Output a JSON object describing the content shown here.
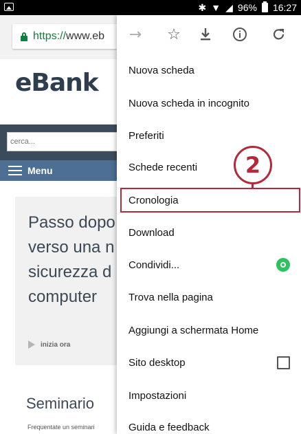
{
  "status_bar": {
    "battery": "96%",
    "time": "16:27",
    "icons": [
      "image-icon",
      "bluetooth-icon",
      "wifi-icon",
      "signal-icon",
      "battery-icon"
    ]
  },
  "browser": {
    "url_scheme": "https://",
    "url_host": "www.eb"
  },
  "page": {
    "logo": "eBank",
    "search_placeholder": "cerca...",
    "menu_label": "Menu",
    "promo_lines": [
      "Passo dopo",
      "verso una n",
      "sicurezza d",
      "computer"
    ],
    "promo_link": "inizia ora",
    "seminar_title": "Seminario",
    "seminar_sub": "Frequentate un seminari"
  },
  "overflow_menu": {
    "toolbar_icons": [
      "forward-icon",
      "star-icon",
      "download-icon",
      "info-icon",
      "refresh-icon"
    ],
    "items": [
      "Nuova scheda",
      "Nuova scheda in incognito",
      "Preferiti",
      "Schede recenti",
      "Cronologia",
      "Download",
      "Condividi...",
      "Trova nella pagina",
      "Aggiungi a schermata Home",
      "Sito desktop",
      "Impostazioni",
      "Guida e feedback"
    ]
  },
  "annotation": {
    "number": "2",
    "color": "#b3293a"
  }
}
